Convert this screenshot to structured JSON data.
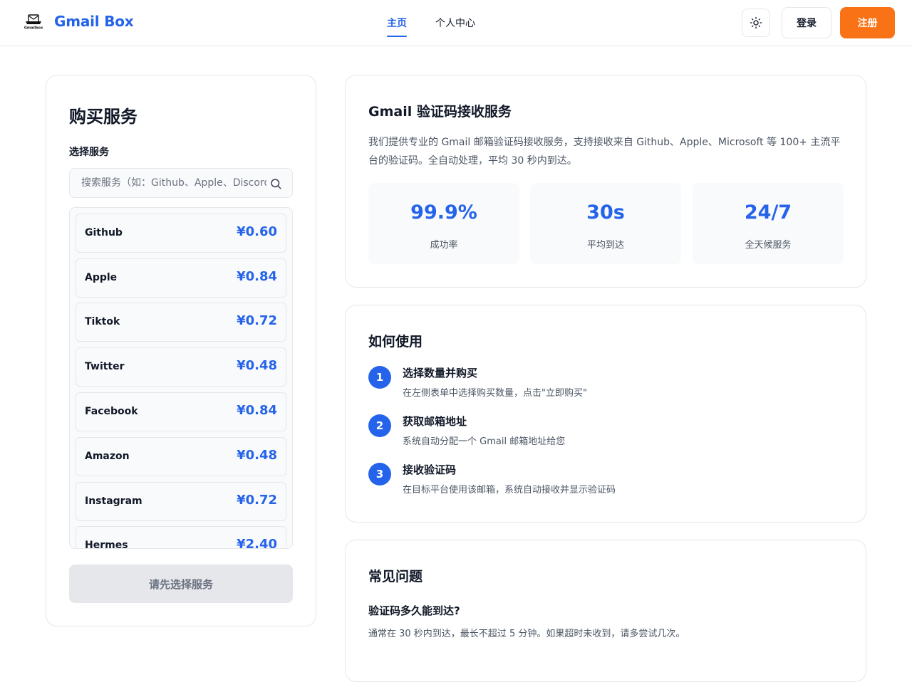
{
  "header": {
    "brand_name": "Gmail Box",
    "logo_text": "Gmailbox",
    "nav": [
      {
        "label": "主页",
        "active": true
      },
      {
        "label": "个人中心",
        "active": false
      }
    ],
    "theme_icon": "sun-icon",
    "login_label": "登录",
    "register_label": "注册",
    "accent_color": "#2563eb",
    "register_color": "#f97316"
  },
  "buy": {
    "title": "购买服务",
    "select_label": "选择服务",
    "search_placeholder": "搜索服务（如：Github、Apple、Discord）",
    "search_icon": "search-icon",
    "services": [
      {
        "name": "Github",
        "price": "¥0.60"
      },
      {
        "name": "Apple",
        "price": "¥0.84"
      },
      {
        "name": "Tiktok",
        "price": "¥0.72"
      },
      {
        "name": "Twitter",
        "price": "¥0.48"
      },
      {
        "name": "Facebook",
        "price": "¥0.84"
      },
      {
        "name": "Amazon",
        "price": "¥0.48"
      },
      {
        "name": "Instagram",
        "price": "¥0.72"
      },
      {
        "name": "Hermes",
        "price": "¥2.40"
      }
    ],
    "button_label": "请先选择服务"
  },
  "intro": {
    "title": "Gmail 验证码接收服务",
    "description": "我们提供专业的 Gmail 邮箱验证码接收服务，支持接收来自 Github、Apple、Microsoft 等 100+ 主流平台的验证码。全自动处理，平均 30 秒内到达。",
    "stats": [
      {
        "value": "99.9%",
        "label": "成功率"
      },
      {
        "value": "30s",
        "label": "平均到达"
      },
      {
        "value": "24/7",
        "label": "全天候服务"
      }
    ]
  },
  "howto": {
    "title": "如何使用",
    "steps": [
      {
        "num": "1",
        "title": "选择数量并购买",
        "desc": "在左侧表单中选择购买数量，点击\"立即购买\""
      },
      {
        "num": "2",
        "title": "获取邮箱地址",
        "desc": "系统自动分配一个 Gmail 邮箱地址给您"
      },
      {
        "num": "3",
        "title": "接收验证码",
        "desc": "在目标平台使用该邮箱，系统自动接收并显示验证码"
      }
    ]
  },
  "faq": {
    "title": "常见问题",
    "items": [
      {
        "q": "验证码多久能到达?",
        "a": "通常在 30 秒内到达，最长不超过 5 分钟。如果超时未收到，请多尝试几次。"
      }
    ]
  }
}
